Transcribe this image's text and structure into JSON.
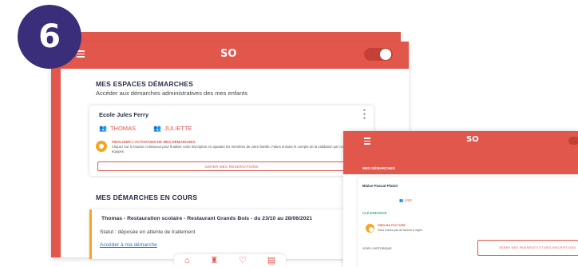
{
  "step_badge": "6",
  "app1": {
    "logo": "SO",
    "section_title": "MES ESPACES DÉMARCHES",
    "section_subtitle": "Accéder aux démarches administratives des mes enfants",
    "school": {
      "name": "Ecole Jules Ferry",
      "children": [
        "THOMAS",
        "JULIETTE"
      ],
      "alert_title": "FINALISER L'ACTIVATION DE MES DÉMARCHES",
      "alert_text_line1": "Cliquez sur le bouton ci-dessous pour finaliser votre inscription en ajoutant les membres de votre famille. Faites ensuite le compte de la validation par nos",
      "alert_text_line2": "équipes.",
      "manage_button": "GÉRER MES RÉSERVATIONS"
    },
    "demarches_title": "MES DÉMARCHES EN COURS",
    "demarche": {
      "title": "Thomas - Restauration scolaire - Restaurant Grands Bois - du 23/10 au 28/06/2021",
      "status": "Statut : déposée en attente de traitement",
      "link": "Accéder à ma démarche"
    },
    "nav_icons": [
      "home-icon",
      "chef-hat-icon",
      "heart-icon",
      "card-icon"
    ]
  },
  "app2": {
    "logo": "SO",
    "header_title": "MES DÉMARCHES",
    "school_name": "Blaise Pascal Plaisir",
    "child": "LISE",
    "wallet_label": "CLÉ ENFANCE",
    "alert_title": "RIEN MA FACTURE",
    "alert_text": "Vous n'avez pas de facture à régler",
    "history_label": "VOIR L'HISTORIQUE",
    "manage_button": "GÉRER MES PAIEMENTS ET MES INSCRIPTIONS"
  },
  "colors": {
    "brand": "#e2574c",
    "accent_dark": "#3a2e7a",
    "warning": "#f5a623",
    "link": "#2f6fd0",
    "success": "#34b08c"
  }
}
